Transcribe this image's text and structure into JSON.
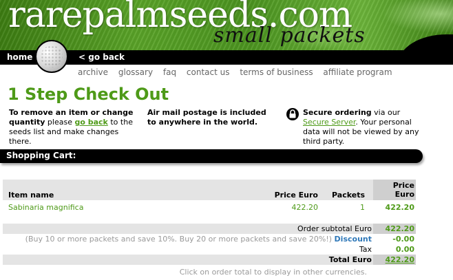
{
  "header": {
    "site_title": "rarepalmseeds.com",
    "site_subtitle": "small packets"
  },
  "nav": {
    "home": "home",
    "go_back": "< go back",
    "links": [
      "archive",
      "glossary",
      "faq",
      "contact us",
      "terms of business",
      "affiliate program"
    ]
  },
  "page_title": "1 Step Check Out",
  "info": {
    "left_prefix": "To remove an item or change quantity",
    "left_mid": " please ",
    "left_link": "go back",
    "left_suffix": " to the seeds list and make changes there.",
    "middle": "Air mail postage is included to anywhere in the world.",
    "right_bold": "Secure ordering",
    "right_mid": " via our ",
    "right_link": "Secure Server",
    "right_suffix": ". Your personal data will not be viewed by any third party."
  },
  "cart": {
    "bar_label": "Shopping Cart:",
    "columns": {
      "item": "Item name",
      "price": "Price Euro",
      "packets": "Packets",
      "total": "Price Euro"
    },
    "items": [
      {
        "name": "Sabinaria magnifica",
        "price": "422.20",
        "packets": "1",
        "total": "422.20"
      }
    ],
    "subtotal_label": "Order subtotal Euro",
    "subtotal": "422.20",
    "discount_note": "(Buy 10 or more packets and save 10%. Buy 20 or more packets and save 20%!)",
    "discount_label": "Discount",
    "discount": "-0.00",
    "tax_label": "Tax",
    "tax": "0.00",
    "total_label": "Total Euro",
    "total": "422.20",
    "currency_note": "Click on order total to display in other currencies."
  },
  "colors": {
    "accent_green": "#4e9a18",
    "bar_black": "#000000",
    "row_shade": "#e4e4e4"
  }
}
